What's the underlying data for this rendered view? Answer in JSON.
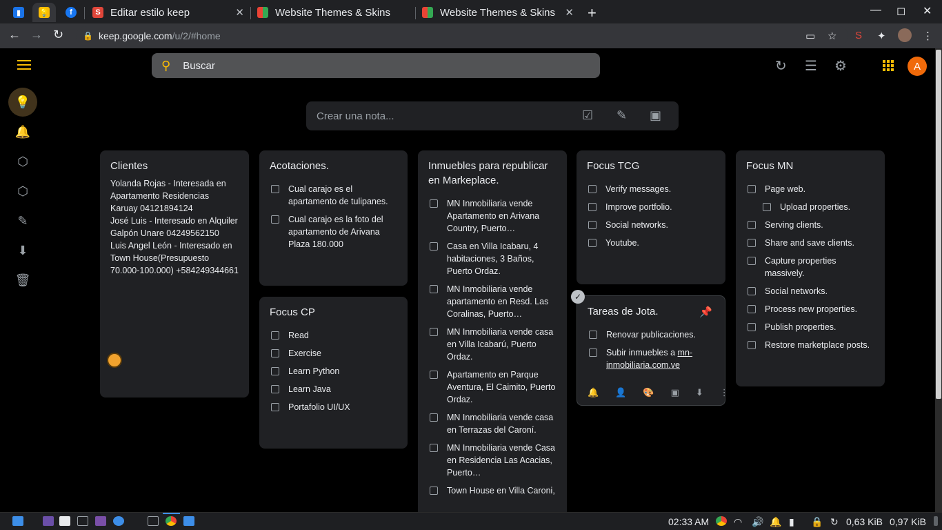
{
  "browser": {
    "tabs": [
      {
        "title": "Editar estilo keep"
      },
      {
        "title": "Website Themes & Skins b"
      },
      {
        "title": "Website Themes & Skins b"
      }
    ],
    "url_host": "keep.google.com",
    "url_path": "/u/2/#home"
  },
  "header": {
    "search_placeholder": "Buscar",
    "avatar_letter": "A"
  },
  "composer": {
    "placeholder": "Crear una nota..."
  },
  "notes": {
    "clientes": {
      "title": "Clientes",
      "lines": [
        "Yolanda Rojas - Interesada en Apartamento Residencias Karuay 04121894124",
        "José Luis - Interesado en Alquiler Galpón Unare 04249562150",
        "Luis Angel León - Interesado en Town House(Presupuesto 70.000-100.000) +584249344661"
      ]
    },
    "acotaciones": {
      "title": "Acotaciones.",
      "items": [
        "Cual carajo es el apartamento de tulipanes.",
        "Cual carajo es la foto del apartamento de Arivana Plaza 180.000"
      ]
    },
    "focus_cp": {
      "title": "Focus CP",
      "items": [
        "Read",
        "Exercise",
        "Learn Python",
        "Learn Java",
        "Portafolio UI/UX"
      ]
    },
    "inmuebles": {
      "title": "Inmuebles para republicar en Markeplace.",
      "items": [
        "MN Inmobiliaria vende Apartamento en Arivana Country, Puerto…",
        "Casa en Villa Icabaru, 4 habitaciones, 3 Baños, Puerto Ordaz.",
        "MN Inmobiliaria vende apartamento en Resd. Las Coralinas, Puerto…",
        "MN Inmobiliaria vende casa en Villa Icabarú, Puerto Ordaz.",
        "Apartamento en Parque Aventura, El Caimito, Puerto Ordaz.",
        "MN Inmobiliaria vende casa en Terrazas del Caroní.",
        "MN Inmobiliaria vende Casa en Residencia Las Acacias, Puerto…",
        "Town House en Villa Caroni,"
      ]
    },
    "focus_tcg": {
      "title": "Focus TCG",
      "items": [
        "Verify messages.",
        "Improve portfolio.",
        "Social networks.",
        "Youtube."
      ]
    },
    "tareas": {
      "title": "Tareas de Jota.",
      "item1": "Renovar publicaciones.",
      "item2_prefix": "Subir inmuebles a ",
      "item2_link": "mn-inmobiliaria.com.ve"
    },
    "focus_mn": {
      "title": "Focus MN",
      "items": [
        "Page web.",
        "Upload properties.",
        "Serving clients.",
        "Share and save clients.",
        "Capture properties massively.",
        "Social networks.",
        "Process new properties.",
        "Publish properties.",
        "Restore marketplace posts."
      ]
    }
  },
  "taskbar": {
    "time": "02:33 AM",
    "net_down": "0,63 KiB",
    "net_up": "0,97 KiB"
  }
}
